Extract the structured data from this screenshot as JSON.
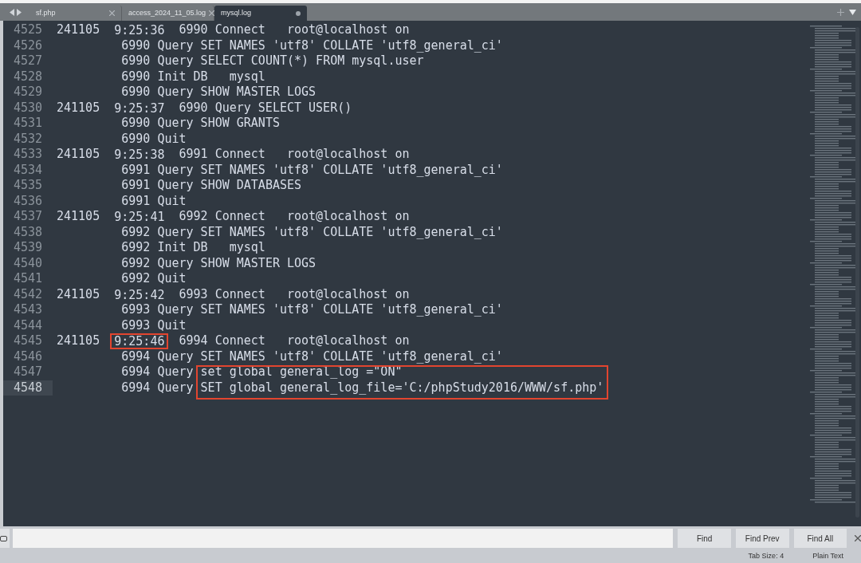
{
  "tabs": [
    {
      "label": "sf.php",
      "selected": false,
      "modified": false
    },
    {
      "label": "access_2024_11_05.log",
      "selected": false,
      "modified": false
    },
    {
      "label": "mysql.log",
      "selected": true,
      "modified": true
    }
  ],
  "lines": [
    {
      "number": "4525",
      "date": "241105",
      "time": "9:25:36",
      "time_marked": false,
      "statement": "6990 Connect   root@localhost on",
      "current": false
    },
    {
      "number": "4526",
      "statement": "6990 Query SET NAMES 'utf8' COLLATE 'utf8_general_ci'",
      "current": false
    },
    {
      "number": "4527",
      "statement": "6990 Query SELECT COUNT(*) FROM mysql.user",
      "current": false
    },
    {
      "number": "4528",
      "statement": "6990 Init DB   mysql",
      "current": false
    },
    {
      "number": "4529",
      "statement": "6990 Query SHOW MASTER LOGS",
      "current": false
    },
    {
      "number": "4530",
      "date": "241105",
      "time": "9:25:37",
      "time_marked": false,
      "statement": "6990 Query SELECT USER()",
      "current": false
    },
    {
      "number": "4531",
      "statement": "6990 Query SHOW GRANTS",
      "current": false
    },
    {
      "number": "4532",
      "statement": "6990 Quit",
      "current": false
    },
    {
      "number": "4533",
      "date": "241105",
      "time": "9:25:38",
      "time_marked": false,
      "statement": "6991 Connect   root@localhost on",
      "current": false
    },
    {
      "number": "4534",
      "statement": "6991 Query SET NAMES 'utf8' COLLATE 'utf8_general_ci'",
      "current": false
    },
    {
      "number": "4535",
      "statement": "6991 Query SHOW DATABASES",
      "current": false
    },
    {
      "number": "4536",
      "statement": "6991 Quit",
      "current": false
    },
    {
      "number": "4537",
      "date": "241105",
      "time": "9:25:41",
      "time_marked": false,
      "statement": "6992 Connect   root@localhost on",
      "current": false
    },
    {
      "number": "4538",
      "statement": "6992 Query SET NAMES 'utf8' COLLATE 'utf8_general_ci'",
      "current": false
    },
    {
      "number": "4539",
      "statement": "6992 Init DB   mysql",
      "current": false
    },
    {
      "number": "4540",
      "statement": "6992 Query SHOW MASTER LOGS",
      "current": false
    },
    {
      "number": "4541",
      "statement": "6992 Quit",
      "current": false
    },
    {
      "number": "4542",
      "date": "241105",
      "time": "9:25:42",
      "time_marked": false,
      "statement": "6993 Connect   root@localhost on",
      "current": false
    },
    {
      "number": "4543",
      "statement": "6993 Query SET NAMES 'utf8' COLLATE 'utf8_general_ci'",
      "current": false
    },
    {
      "number": "4544",
      "statement": "6993 Quit",
      "current": false
    },
    {
      "number": "4545",
      "date": "241105",
      "time": "9:25:46",
      "time_marked": true,
      "statement": "6994 Connect   root@localhost on",
      "current": false
    },
    {
      "number": "4546",
      "statement": "6994 Query SET NAMES 'utf8' COLLATE 'utf8_general_ci'",
      "current": false
    },
    {
      "number": "4547",
      "statement": "6994 Query",
      "argument": "set global general_log =\"ON\"",
      "argument_marked": true,
      "current": false
    },
    {
      "number": "4548",
      "statement": "6994 Query",
      "argument": "SET global general_log_file='C:/phpStudy2016/WWW/sf.php'",
      "argument_marked": true,
      "current": true
    }
  ],
  "find_panel": {
    "buttons": [
      "Find",
      "Find Prev",
      "Find All"
    ]
  },
  "status_bar": {
    "tab_size": "Tab Size: 4",
    "syntax": "Plain Text"
  }
}
